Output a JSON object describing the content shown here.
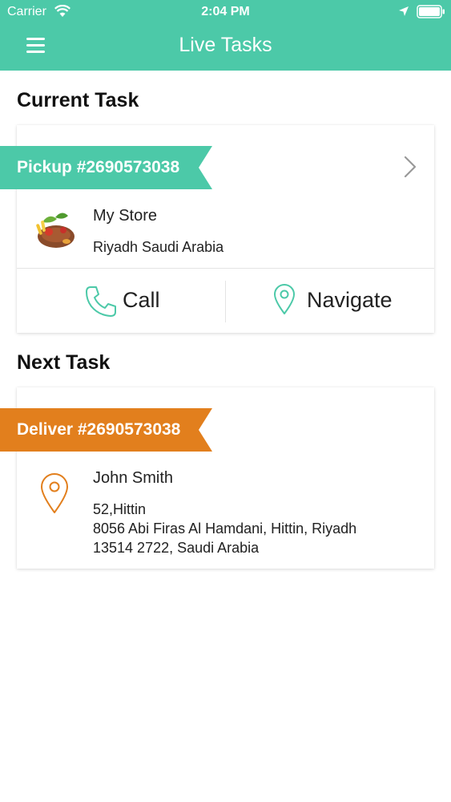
{
  "status_bar": {
    "carrier": "Carrier",
    "time": "2:04 PM",
    "icons": [
      "wifi-icon",
      "location-arrow-icon",
      "battery-icon"
    ]
  },
  "nav": {
    "title": "Live Tasks",
    "menu_icon": "menu-icon"
  },
  "current_section_title": "Current Task",
  "current_task": {
    "ribbon_label": "Pickup #2690573038",
    "ribbon_color": "#4cc9a8",
    "store_name": "My Store",
    "store_address": "Riyadh Saudi Arabia",
    "actions": {
      "call_label": "Call",
      "navigate_label": "Navigate"
    }
  },
  "next_section_title": "Next Task",
  "next_task": {
    "ribbon_label": "Deliver #2690573038",
    "ribbon_color": "#e27f1d",
    "customer_name": "John Smith",
    "address_lines": [
      "52,Hittin",
      "8056 Abi Firas Al Hamdani,  Hittin,  Riyadh",
      "13514 2722,  Saudi Arabia"
    ]
  },
  "colors": {
    "accent_green": "#4cc9a8",
    "accent_orange": "#e27f1d"
  }
}
